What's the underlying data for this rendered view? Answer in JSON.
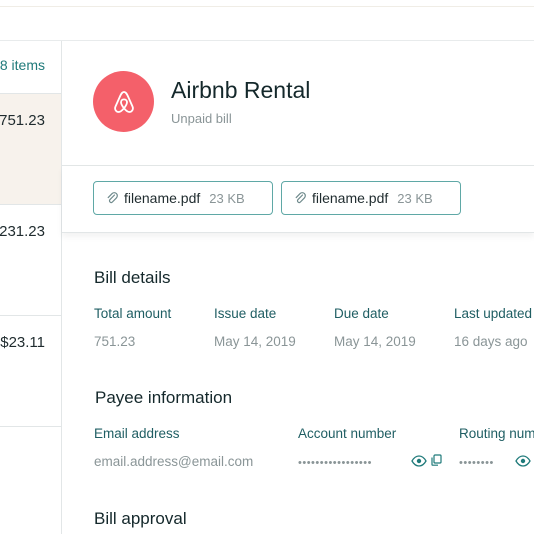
{
  "list": {
    "items_count": "8 items",
    "rows": [
      {
        "amount": "751.23"
      },
      {
        "amount": "231.23"
      },
      {
        "amount": "$23.11"
      }
    ]
  },
  "bill": {
    "title": "Airbnb Rental",
    "status": "Unpaid bill",
    "logo_icon": "airbnb-logo",
    "brand_color": "#f4606a",
    "accent_color": "#1f7a7a"
  },
  "attachments": [
    {
      "name": "filename.pdf",
      "size": "23 KB"
    },
    {
      "name": "filename.pdf",
      "size": "23 KB"
    }
  ],
  "bill_details": {
    "title": "Bill details",
    "fields": [
      {
        "label": "Total amount",
        "value": "751.23"
      },
      {
        "label": "Issue date",
        "value": "May 14, 2019"
      },
      {
        "label": "Due date",
        "value": "May 14, 2019"
      },
      {
        "label": "Last updated",
        "value": "16 days ago"
      }
    ]
  },
  "payee": {
    "title": "Payee information",
    "email_label": "Email address",
    "email_value": "email.address@email.com",
    "account_label": "Account number",
    "account_value": "•••••••••••••••••",
    "routing_label": "Routing number",
    "routing_value": "••••••••"
  },
  "approval": {
    "title": "Bill approval"
  }
}
